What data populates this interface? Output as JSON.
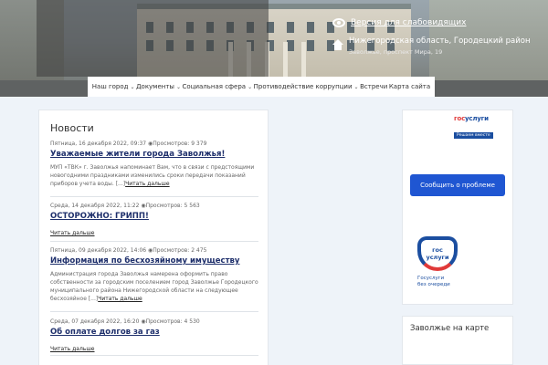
{
  "header": {
    "access_label": "Версия для слабовидящих",
    "region_line1": "Нижегородская область, Городецкий район",
    "region_line2": "Заволжье, проспект Мира, 19"
  },
  "nav": {
    "items": [
      {
        "label": "Наш город",
        "dropdown": true
      },
      {
        "label": "Документы",
        "dropdown": true
      },
      {
        "label": "Социальная сфера",
        "dropdown": true
      },
      {
        "label": "Противодействие коррупции",
        "dropdown": true
      },
      {
        "label": "Встречи",
        "dropdown": false
      },
      {
        "label": "Карта сайта",
        "dropdown": false
      }
    ]
  },
  "news": {
    "title": "Новости",
    "items": [
      {
        "meta": "Пятница, 16 декабря 2022, 09:37",
        "views": "Просмотров: 9 379",
        "headline": "Уважаемые жители города Заволжья!",
        "excerpt": "МУП «ТВК» г. Заволжья напоминает Вам, что в связи с предстоящими новогодними праздниками изменились сроки передачи показаний приборов учета воды. [...]",
        "more": "Читать дальше"
      },
      {
        "meta": "Среда, 14 декабря 2022, 11:22",
        "views": "Просмотров: 5 563",
        "headline": "ОСТОРОЖНО: ГРИПП!",
        "excerpt": "",
        "more": "Читать дальше"
      },
      {
        "meta": "Пятница, 09 декабря 2022, 14:06",
        "views": "Просмотров: 2 475",
        "headline": "Информация по бесхозяйному имуществу",
        "excerpt": "Администрация города Заволжья намерена оформить право собственности за городским поселением город Заволжье Городецкого муниципального района Нижегородской области на следующее бесхозяйное [...]",
        "more": "Читать дальше"
      },
      {
        "meta": "Среда, 07 декабря 2022, 16:20",
        "views": "Просмотров: 4 530",
        "headline": "Об оплате долгов за газ",
        "excerpt": "",
        "more": "Читать дальше"
      }
    ]
  },
  "sidebar": {
    "gos_brand_a": "гос",
    "gos_brand_b": "услуги",
    "gos_tag": "Решаем вместе",
    "report_button": "Сообщить о проблеме",
    "gos_logo_line1": "гос",
    "gos_logo_line2": "услуги",
    "gos_logo_sub1": "Госуслуги",
    "gos_logo_sub2": "без очереди",
    "map_title": "Заволжье на карте"
  },
  "colors": {
    "accent": "#1f56d2",
    "headline": "#1e2f6b",
    "background": "#eef3f9"
  }
}
